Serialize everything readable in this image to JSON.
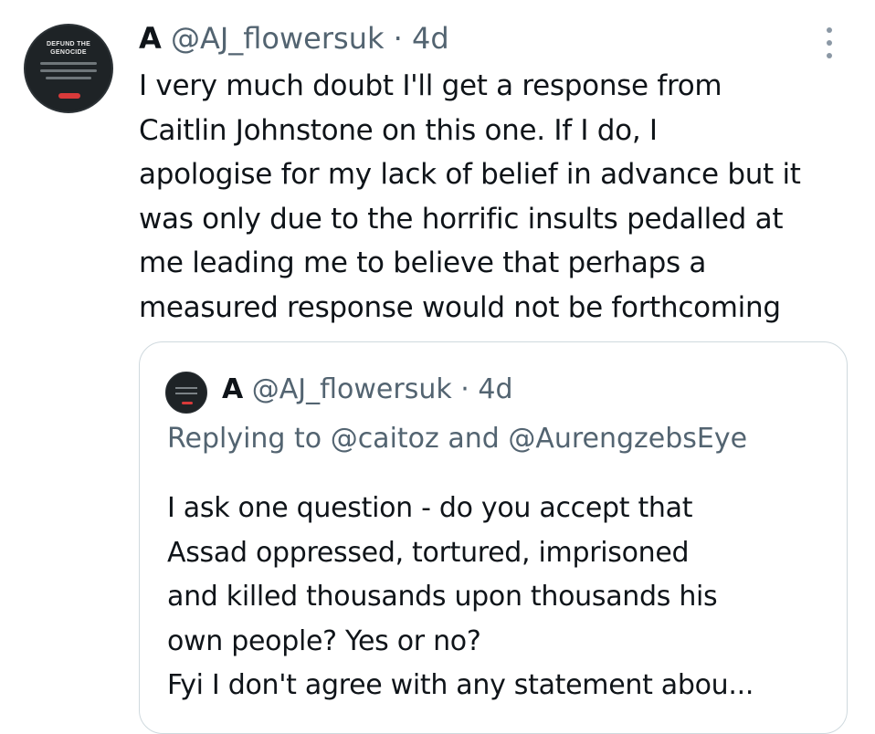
{
  "tweet": {
    "avatar": {
      "title": "DEFUND THE\nGENOCIDE"
    },
    "name": "A",
    "handle": "@AJ_flowersuk",
    "separator": "·",
    "time": "4d",
    "more_icon": "more-vertical-icon",
    "text_lines": [
      "I very much doubt I'll get a response from",
      "Caitlin Johnstone on this one. If I do, I",
      "apologise for my lack of belief in advance but it",
      "was only due to the horrific insults pedalled at",
      "me leading me to believe that perhaps a",
      "measured response would not be forthcoming"
    ]
  },
  "quote": {
    "name": "A",
    "handle": "@AJ_flowersuk",
    "separator": "·",
    "time": "4d",
    "replying_prefix": "Replying to",
    "mention_1": "@caitoz",
    "conjunction": "and",
    "mention_2": "@AurengzebsEye",
    "text_lines": [
      "I ask one question - do you accept that",
      "Assad oppressed, tortured, imprisoned",
      "and killed thousands upon thousands his",
      "own people? Yes or no?",
      "Fyi I don't agree with any statement abou..."
    ]
  },
  "colors": {
    "text_primary": "#0f1419",
    "text_secondary": "#536471",
    "border": "#cfd9de"
  }
}
